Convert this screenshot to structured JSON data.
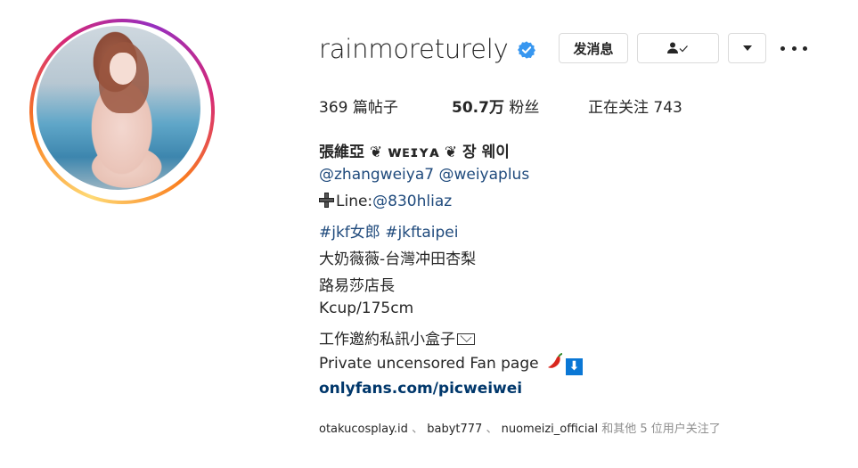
{
  "profile": {
    "username": "rainmoreturely",
    "verified_icon": "verified-badge-icon",
    "buttons": {
      "message": "发消息",
      "follow_icon": "person-check-icon",
      "suggest_icon": "caret-down-icon",
      "more_icon": "more-horizontal-icon"
    },
    "stats": {
      "posts_count": "369",
      "posts_label": "篇帖子",
      "followers_count": "50.7万",
      "followers_label": "粉丝",
      "following_label": "正在关注",
      "following_count": "743"
    },
    "bio": {
      "full_name": "張維亞 ❦ ᴡᴇɪʏᴀ ❦ 장 웨이",
      "mention_1": "@zhangweiya7",
      "mention_2": "@weiyaplus",
      "line_prefix": "Line:",
      "line_id": "@830hliaz",
      "hashtag_1": "#jkf女郎",
      "hashtag_2": "#jkftaipei",
      "line_1": "大奶薇薇-台灣冲田杏梨",
      "line_2": "路易莎店長",
      "line_3": "Kcup/175cm",
      "line_4": "工作邀約私訊小盒子",
      "line_5": "Private uncensored Fan page",
      "down_arrow": "⬇",
      "url": "onlyfans.com/picweiwei"
    },
    "followed_by": {
      "accounts": [
        "otakucosplay.id",
        "babyt777",
        "nuomeizi_official"
      ],
      "separator": "、",
      "suffix": "和其他 5 位用户关注了"
    }
  },
  "colors": {
    "link": "#1f4a7c",
    "url": "#00376b",
    "verified": "#3897f0",
    "muted": "#8e8e8e"
  }
}
